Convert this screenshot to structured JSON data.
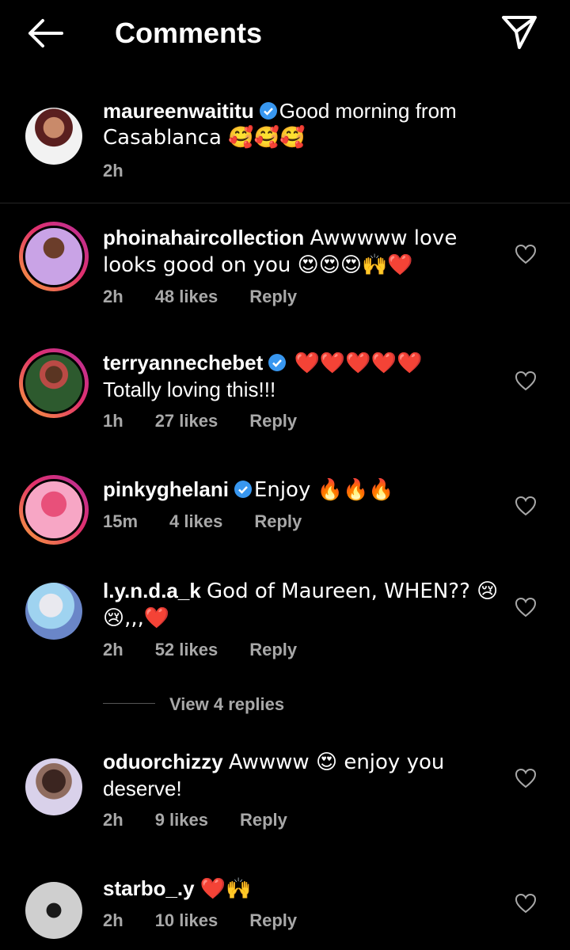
{
  "header": {
    "title": "Comments"
  },
  "caption": {
    "username": "maureenwaititu",
    "text_line1": "Good morning from",
    "text_line2": "Casablanca 🥰🥰🥰",
    "time": "2h"
  },
  "comments": [
    {
      "username": "phoinahaircollection",
      "text": "Awwwww love looks good on you 😍😍😍🙌❤️",
      "time": "2h",
      "likes": "48 likes",
      "reply": "Reply"
    },
    {
      "username": "terryannechebet",
      "text": "❤️❤️❤️❤️❤️",
      "text2": "Totally loving this!!!",
      "time": "1h",
      "likes": "27 likes",
      "reply": "Reply"
    },
    {
      "username": "pinkyghelani",
      "text": "Enjoy 🔥🔥🔥",
      "time": "15m",
      "likes": "4 likes",
      "reply": "Reply"
    },
    {
      "username": "l.y.n.d.a_k",
      "text": "God of Maureen, WHEN?? 😢",
      "text2": "😢,,,❤️",
      "time": "2h",
      "likes": "52 likes",
      "reply": "Reply"
    },
    {
      "username": "oduorchizzy",
      "text": "Awwww 😍 enjoy you",
      "text2": "deserve!",
      "time": "2h",
      "likes": "9 likes",
      "reply": "Reply"
    },
    {
      "username": "starbo_.y",
      "text": "❤️🙌",
      "time": "2h",
      "likes": "10 likes",
      "reply": "Reply"
    }
  ],
  "view_replies": "View 4 replies",
  "colors": {
    "background": "#000000",
    "text": "#ffffff",
    "secondary": "#a8a8a8",
    "verified": "#3897f0",
    "heart_red": "#ed4956"
  }
}
